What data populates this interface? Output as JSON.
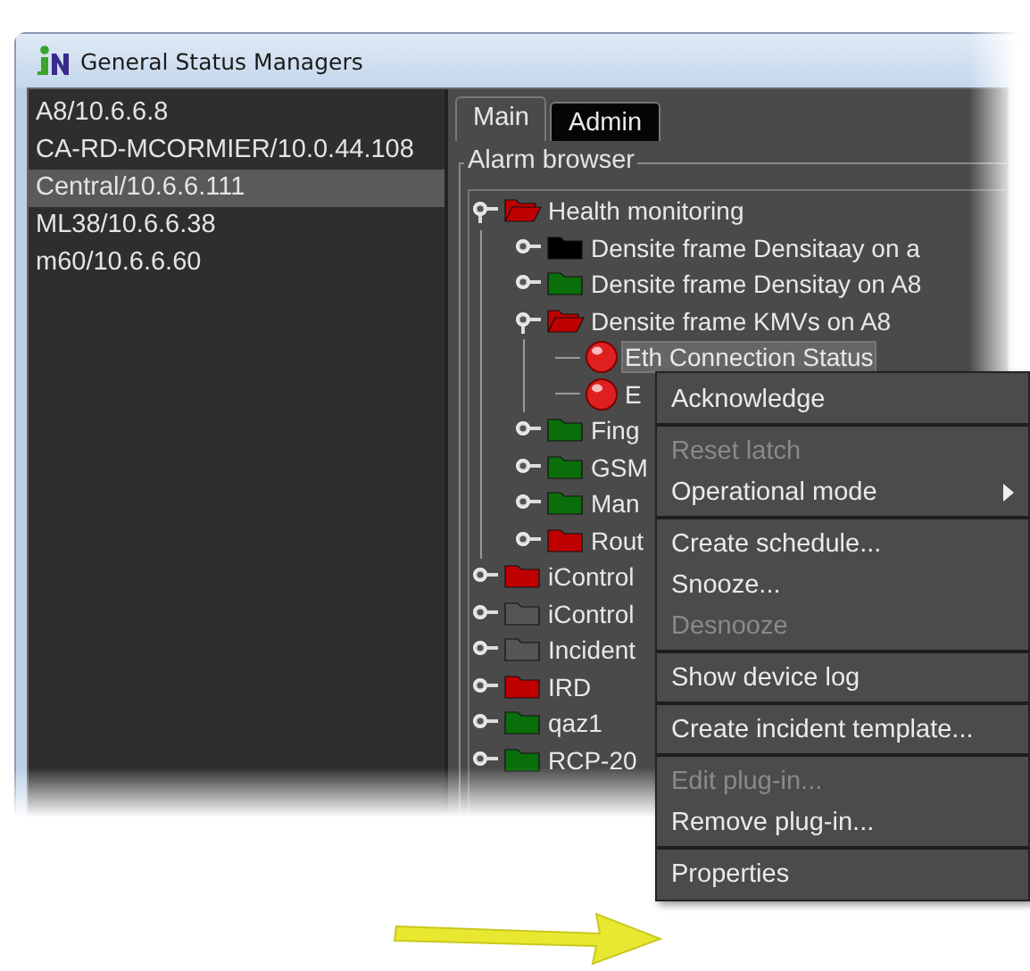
{
  "window": {
    "title": "General Status Managers"
  },
  "managers": [
    {
      "label": "A8/10.6.6.8",
      "selected": false
    },
    {
      "label": "CA-RD-MCORMIER/10.0.44.108",
      "selected": false
    },
    {
      "label": "Central/10.6.6.111",
      "selected": true
    },
    {
      "label": "ML38/10.6.6.38",
      "selected": false
    },
    {
      "label": "m60/10.6.6.60",
      "selected": false
    }
  ],
  "tabs": [
    {
      "label": "Main",
      "selected": true
    },
    {
      "label": "Admin",
      "selected": false
    }
  ],
  "alarm_browser": {
    "title": "Alarm browser",
    "tree": [
      {
        "kind": "folder",
        "label": "Health monitoring",
        "color": "#c00000",
        "expanded": true,
        "selected": false,
        "children": [
          {
            "kind": "folder",
            "label": "Densite frame Densitaay on a",
            "color": "#000000",
            "expanded": false,
            "selected": false
          },
          {
            "kind": "folder",
            "label": "Densite frame Densitay on A8",
            "color": "#0a6e0a",
            "expanded": false,
            "selected": false
          },
          {
            "kind": "folder",
            "label": "Densite frame KMVs on A8",
            "color": "#c00000",
            "expanded": true,
            "selected": false,
            "children": [
              {
                "kind": "alarm",
                "label": "Eth Connection Status",
                "color": "#e02020",
                "selected": true
              },
              {
                "kind": "alarm",
                "label": "E",
                "color": "#e02020",
                "selected": false
              }
            ]
          },
          {
            "kind": "folder",
            "label": "Fing",
            "color": "#0a6e0a",
            "expanded": false,
            "selected": false
          },
          {
            "kind": "folder",
            "label": "GSM",
            "color": "#0a6e0a",
            "expanded": false,
            "selected": false
          },
          {
            "kind": "folder",
            "label": "Man",
            "color": "#0a6e0a",
            "expanded": false,
            "selected": false
          },
          {
            "kind": "folder",
            "label": "Rout",
            "color": "#c00000",
            "expanded": false,
            "selected": false
          }
        ]
      },
      {
        "kind": "folder",
        "label": "iControl",
        "color": "#c00000",
        "expanded": false,
        "selected": false
      },
      {
        "kind": "folder",
        "label": "iControl",
        "color": "#555555",
        "expanded": false,
        "selected": false
      },
      {
        "kind": "folder",
        "label": "Incident",
        "color": "#555555",
        "expanded": false,
        "selected": false
      },
      {
        "kind": "folder",
        "label": "IRD",
        "color": "#c00000",
        "expanded": false,
        "selected": false
      },
      {
        "kind": "folder",
        "label": "qaz1",
        "color": "#0a6e0a",
        "expanded": false,
        "selected": false
      },
      {
        "kind": "folder",
        "label": "RCP-20",
        "color": "#0a6e0a",
        "expanded": false,
        "selected": false
      }
    ]
  },
  "context_menu": [
    [
      {
        "label": "Acknowledge",
        "disabled": false,
        "submenu": false
      }
    ],
    [
      {
        "label": "Reset latch",
        "disabled": true,
        "submenu": false
      },
      {
        "label": "Operational mode",
        "disabled": false,
        "submenu": true
      }
    ],
    [
      {
        "label": "Create schedule...",
        "disabled": false,
        "submenu": false
      },
      {
        "label": "Snooze...",
        "disabled": false,
        "submenu": false
      },
      {
        "label": "Desnooze",
        "disabled": true,
        "submenu": false
      }
    ],
    [
      {
        "label": "Show device log",
        "disabled": false,
        "submenu": false
      }
    ],
    [
      {
        "label": "Create incident template...",
        "disabled": false,
        "submenu": false
      }
    ],
    [
      {
        "label": "Edit plug-in...",
        "disabled": true,
        "submenu": false
      },
      {
        "label": "Remove plug-in...",
        "disabled": false,
        "submenu": false
      }
    ],
    [
      {
        "label": "Properties",
        "disabled": false,
        "submenu": false
      }
    ]
  ]
}
